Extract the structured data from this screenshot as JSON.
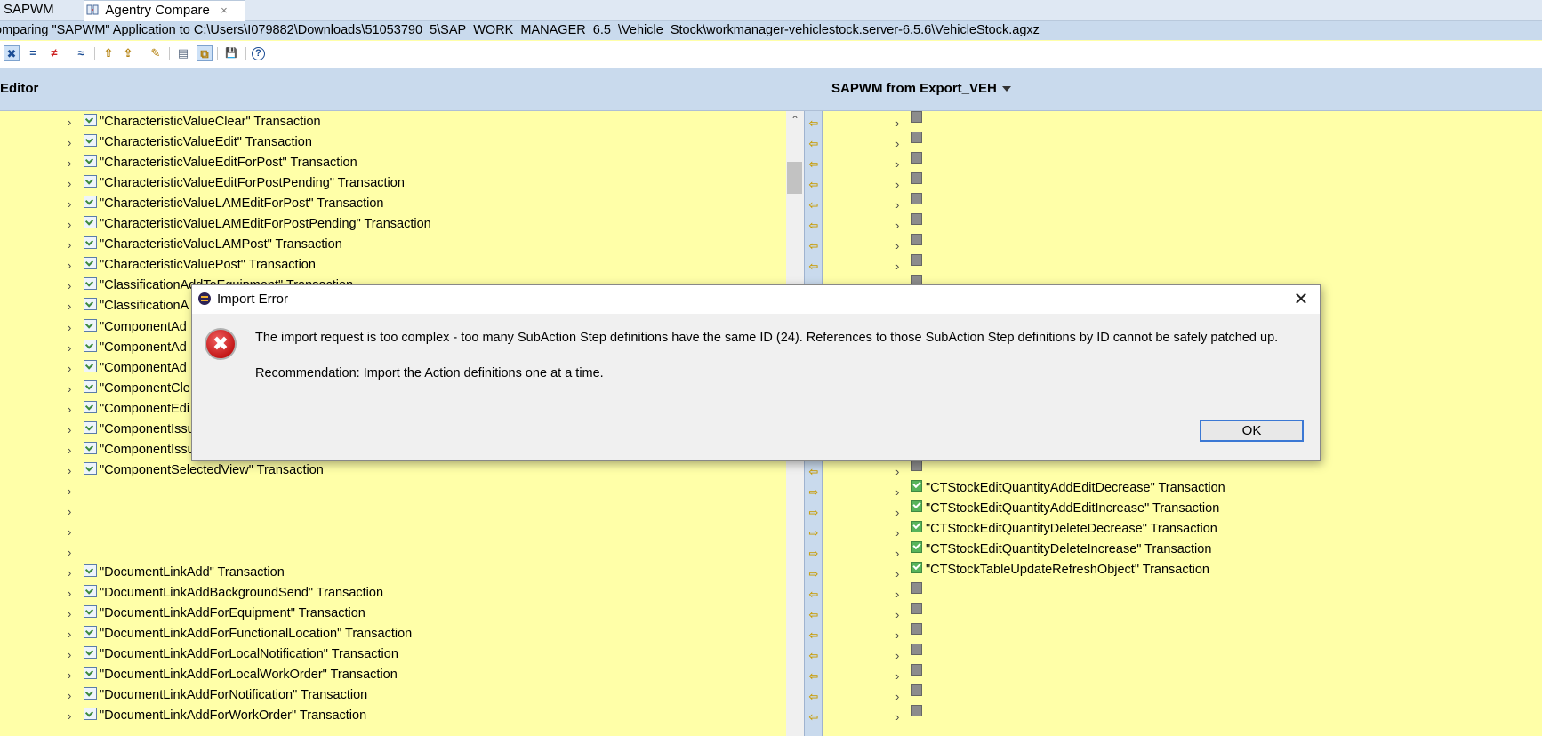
{
  "tabs": [
    {
      "label": "SAPWM"
    },
    {
      "label": "Agentry Compare",
      "close": "×"
    }
  ],
  "path": "omparing \"SAPWM\" Application to C:\\Users\\I079882\\Downloads\\51053790_5\\SAP_WORK_MANAGER_6.5_\\Vehicle_Stock\\workmanager-vehiclestock.server-6.5.6\\VehicleStock.agxz",
  "toolbar": {
    "icons": [
      "x-icon",
      "equals-icon",
      "not-equals-icon",
      "approx-icon",
      "import-icon",
      "import-all-icon",
      "highlight-icon",
      "pane-icon",
      "sync-icon",
      "save-icon",
      "help-icon"
    ],
    "glyphs": [
      "✖",
      "=",
      "≠",
      "≈",
      "⇧",
      "⇪",
      "✎",
      "▤",
      "⧉",
      "💾",
      "?"
    ]
  },
  "left_title": "Editor",
  "right_title": "SAPWM from Export_VEH",
  "left_rows": [
    {
      "label": "\"CharacteristicValueClear\" Transaction"
    },
    {
      "label": "\"CharacteristicValueEdit\" Transaction"
    },
    {
      "label": "\"CharacteristicValueEditForPost\" Transaction"
    },
    {
      "label": "\"CharacteristicValueEditForPostPending\" Transaction"
    },
    {
      "label": "\"CharacteristicValueLAMEditForPost\" Transaction"
    },
    {
      "label": "\"CharacteristicValueLAMEditForPostPending\" Transaction"
    },
    {
      "label": "\"CharacteristicValueLAMPost\" Transaction"
    },
    {
      "label": "\"CharacteristicValuePost\" Transaction"
    },
    {
      "label": "\"ClassificationAddToEquipment\" Transaction"
    },
    {
      "label": "\"ClassificationA"
    },
    {
      "label": "\"ComponentAd"
    },
    {
      "label": "\"ComponentAd"
    },
    {
      "label": "\"ComponentAd"
    },
    {
      "label": "\"ComponentCle"
    },
    {
      "label": "\"ComponentEdi"
    },
    {
      "label": "\"ComponentIssu"
    },
    {
      "label": "\"ComponentIssu"
    },
    {
      "label": "\"ComponentSelectedView\" Transaction"
    },
    {
      "label": ""
    },
    {
      "label": ""
    },
    {
      "label": ""
    },
    {
      "label": ""
    },
    {
      "label": "\"DocumentLinkAdd\" Transaction"
    },
    {
      "label": "\"DocumentLinkAddBackgroundSend\" Transaction"
    },
    {
      "label": "\"DocumentLinkAddForEquipment\" Transaction"
    },
    {
      "label": "\"DocumentLinkAddForFunctionalLocation\" Transaction"
    },
    {
      "label": "\"DocumentLinkAddForLocalNotification\" Transaction"
    },
    {
      "label": "\"DocumentLinkAddForLocalWorkOrder\" Transaction"
    },
    {
      "label": "\"DocumentLinkAddForNotification\" Transaction"
    },
    {
      "label": "\"DocumentLinkAddForWorkOrder\" Transaction"
    }
  ],
  "right_rows": [
    {
      "label": ""
    },
    {
      "label": ""
    },
    {
      "label": ""
    },
    {
      "label": ""
    },
    {
      "label": ""
    },
    {
      "label": ""
    },
    {
      "label": ""
    },
    {
      "label": ""
    },
    {
      "label": ""
    },
    {
      "label": ""
    },
    {
      "label": ""
    },
    {
      "label": ""
    },
    {
      "label": ""
    },
    {
      "label": ""
    },
    {
      "label": ""
    },
    {
      "label": ""
    },
    {
      "label": ""
    },
    {
      "label": ""
    },
    {
      "label": "\"CTStockEditQuantityAddEditDecrease\" Transaction",
      "checked": true
    },
    {
      "label": "\"CTStockEditQuantityAddEditIncrease\" Transaction",
      "checked": true
    },
    {
      "label": "\"CTStockEditQuantityDeleteDecrease\" Transaction",
      "checked": true
    },
    {
      "label": "\"CTStockEditQuantityDeleteIncrease\" Transaction",
      "checked": true
    },
    {
      "label": "\"CTStockTableUpdateRefreshObject\" Transaction",
      "checked": true
    },
    {
      "label": ""
    },
    {
      "label": ""
    },
    {
      "label": ""
    },
    {
      "label": ""
    },
    {
      "label": ""
    },
    {
      "label": ""
    },
    {
      "label": ""
    }
  ],
  "gutter_arrows": [
    "⇦",
    "⇦",
    "⇦",
    "⇦",
    "⇦",
    "⇦",
    "⇦",
    "⇦",
    "⇦",
    "⇦",
    "⇦",
    "⇦",
    "⇦",
    "⇦",
    "⇦",
    "⇦",
    "⇦",
    "⇦",
    "⇨",
    "⇨",
    "⇨",
    "⇨",
    "⇨",
    "⇦",
    "⇦",
    "⇦",
    "⇦",
    "⇦",
    "⇦",
    "⇦"
  ],
  "dialog": {
    "title": "Import Error",
    "close": "✕",
    "message": "The import request is too complex - too many SubAction Step definitions have the same ID (24). References to those SubAction Step definitions by ID cannot be safely patched up.",
    "recommendation": "Recommendation: Import the Action definitions one at a time.",
    "ok_label": "OK",
    "error_glyph": "✖"
  },
  "colors": {
    "pane_bg": "#ffffa8",
    "header_bg": "#c9daed",
    "dialog_bg": "#f0f0f0",
    "ok_border": "#3b78d4"
  }
}
